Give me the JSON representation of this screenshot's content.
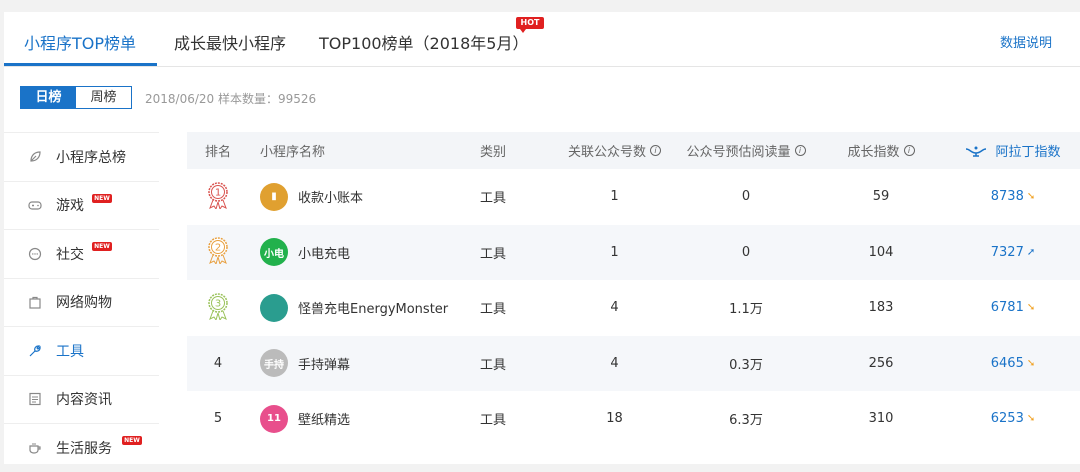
{
  "tabs": {
    "items": [
      {
        "label": "小程序TOP榜单"
      },
      {
        "label": "成长最快小程序"
      },
      {
        "label": "TOP100榜单（2018年5月）"
      }
    ],
    "hot_badge": "HOT",
    "data_note": "数据说明"
  },
  "switch": {
    "day": "日榜",
    "week": "周榜"
  },
  "meta": "2018/06/20 样本数量：99526",
  "sidebar": {
    "new_badge": "NEW",
    "items": [
      {
        "label": "小程序总榜",
        "icon": "leaf-icon"
      },
      {
        "label": "游戏",
        "icon": "gamepad-icon",
        "new": true
      },
      {
        "label": "社交",
        "icon": "chat-icon",
        "new": true
      },
      {
        "label": "网络购物",
        "icon": "bag-icon"
      },
      {
        "label": "工具",
        "icon": "wrench-icon"
      },
      {
        "label": "内容资讯",
        "icon": "document-icon"
      },
      {
        "label": "生活服务",
        "icon": "cup-icon",
        "new": true
      }
    ]
  },
  "table": {
    "headers": {
      "rank": "排名",
      "name": "小程序名称",
      "category": "类别",
      "fans": "关联公众号数",
      "reads": "公众号预估阅读量",
      "growth": "成长指数",
      "aladdin": "阿拉丁指数"
    },
    "rows": [
      {
        "rank": "1",
        "name": "收款小账本",
        "category": "工具",
        "fans": "1",
        "reads": "0",
        "growth": "59",
        "index": "8738",
        "trend": "down",
        "icon_color": "#e0a030",
        "icon_text": "▮"
      },
      {
        "rank": "2",
        "name": "小电充电",
        "category": "工具",
        "fans": "1",
        "reads": "0",
        "growth": "104",
        "index": "7327",
        "trend": "up",
        "icon_color": "#22b14c",
        "icon_text": "小电"
      },
      {
        "rank": "3",
        "name": "怪兽充电EnergyMonster",
        "category": "工具",
        "fans": "4",
        "reads": "1.1万",
        "growth": "183",
        "index": "6781",
        "trend": "down",
        "icon_color": "#2a9d8f",
        "icon_text": ""
      },
      {
        "rank": "4",
        "name": "手持弹幕",
        "category": "工具",
        "fans": "4",
        "reads": "0.3万",
        "growth": "256",
        "index": "6465",
        "trend": "down",
        "icon_color": "#bbbbbb",
        "icon_text": "手持"
      },
      {
        "rank": "5",
        "name": "壁纸精选",
        "category": "工具",
        "fans": "18",
        "reads": "6.3万",
        "growth": "310",
        "index": "6253",
        "trend": "down",
        "icon_color": "#e84f8c",
        "icon_text": "11"
      }
    ]
  },
  "colors": {
    "accent": "#1a73c8",
    "badge_red": "#e02020",
    "medal_1": "#d9534f",
    "medal_2": "#e8a040",
    "medal_3": "#9ac25a",
    "trend_down": "#f0a020",
    "trend_up": "#1a73c8"
  }
}
